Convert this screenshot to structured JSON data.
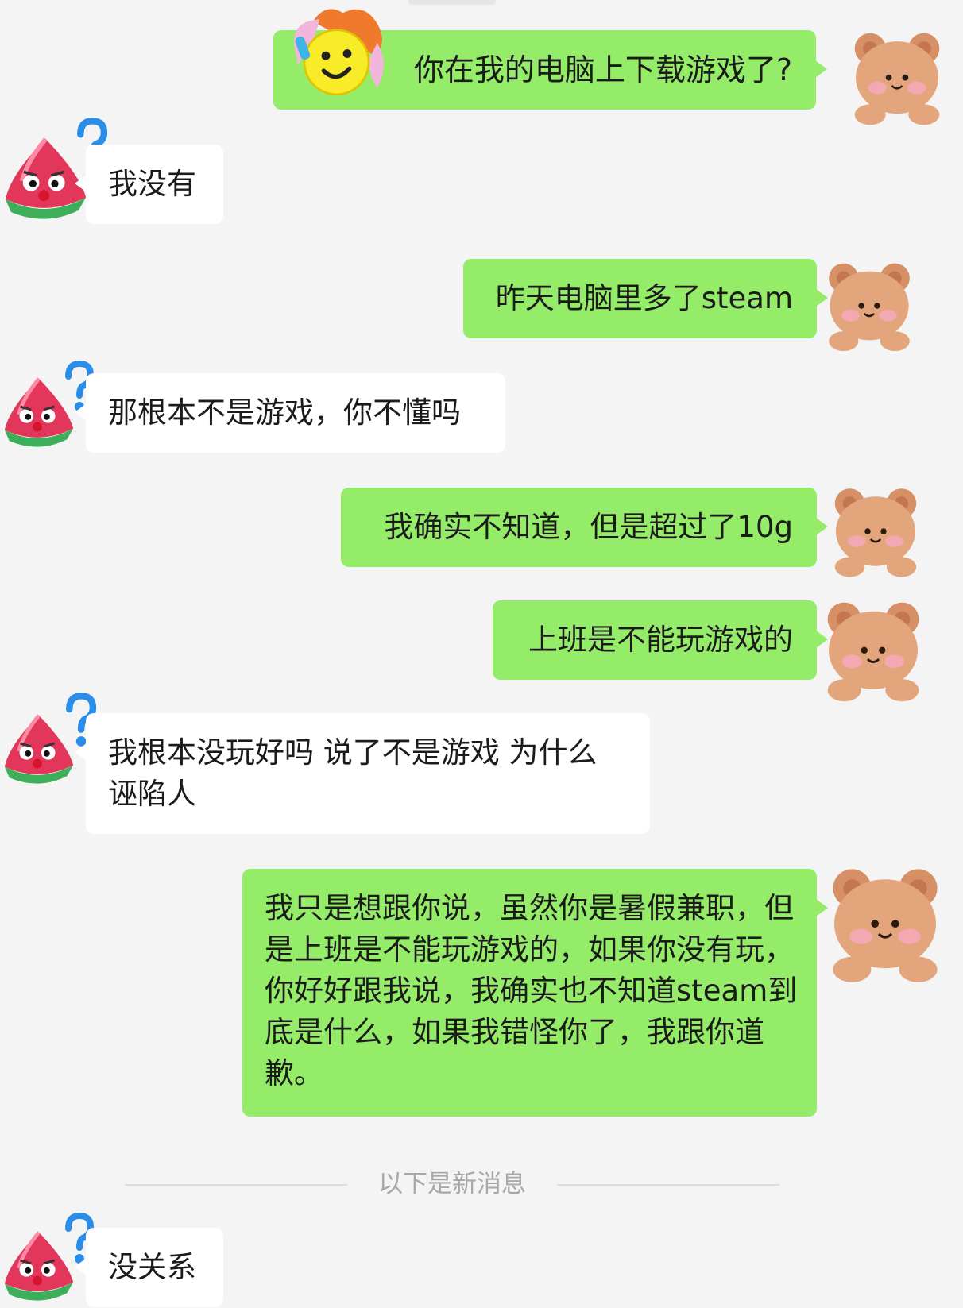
{
  "messages": [
    {
      "side": "out",
      "text": "你在我的电脑上下载游戏了?"
    },
    {
      "side": "in",
      "text": "我没有"
    },
    {
      "side": "out",
      "text": "昨天电脑里多了steam"
    },
    {
      "side": "in",
      "text": "那根本不是游戏，你不懂吗"
    },
    {
      "side": "out",
      "text": "我确实不知道，但是超过了10g"
    },
    {
      "side": "out",
      "text": "上班是不能玩游戏的"
    },
    {
      "side": "in",
      "text": "我根本没玩好吗 说了不是游戏 为什么诬陷人"
    },
    {
      "side": "out",
      "text": "我只是想跟你说，虽然你是暑假兼职，但是上班是不能玩游戏的，如果你没有玩，你好好跟我说，我确实也不知道steam到底是什么，如果我错怪你了，我跟你道歉。"
    },
    {
      "side": "in",
      "text": "没关系"
    }
  ],
  "divider": {
    "label": "以下是新消息"
  },
  "avatars": {
    "self": "teddy-bear-avatar",
    "other": "watermelon-question-avatar",
    "sticker": "emoji-face-sticker"
  },
  "colors": {
    "background": "#f4f4f4",
    "outgoing_bubble": "#95ec69",
    "incoming_bubble": "#ffffff",
    "text": "#1b1b1b",
    "divider_text": "#a8a8a8"
  }
}
